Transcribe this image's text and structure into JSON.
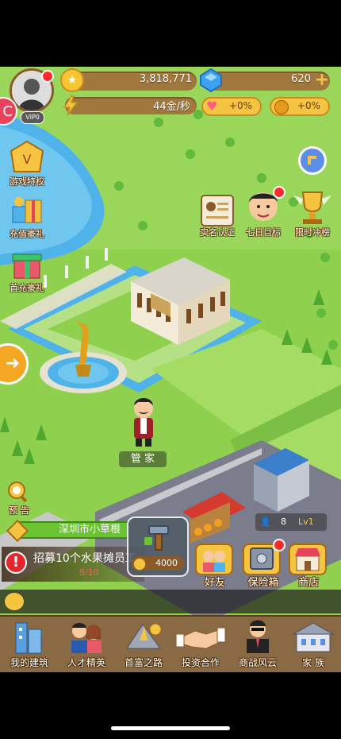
{
  "hud": {
    "avatar_level": "VIP0",
    "gold": "3,818,771",
    "diamonds": "620",
    "income": "44金/秒",
    "bonus_heart": "+0%",
    "bonus_coin": "+0%"
  },
  "left_menu": [
    {
      "label": "游戏特权",
      "icon": "vip-crown-icon"
    },
    {
      "label": "充值豪礼",
      "icon": "gift-pile-icon"
    },
    {
      "label": "首充豪礼",
      "icon": "gift-box-icon"
    }
  ],
  "events": [
    {
      "label": "实名认证",
      "icon": "id-card-icon"
    },
    {
      "label": "七日目标",
      "icon": "character-avatar-icon"
    },
    {
      "label": "限时冲榜",
      "icon": "trophy-icon"
    }
  ],
  "map": {
    "character_name": "管 家",
    "preview_label": "预 告"
  },
  "location": {
    "name": "深圳市小草根"
  },
  "task": {
    "text": "招募10个水果摊员工",
    "progress": "8/10"
  },
  "build": {
    "cost": "4000"
  },
  "shop_stats": {
    "staff": "8",
    "level": "Lv1"
  },
  "right_buttons": [
    {
      "label": "好友",
      "icon": "friends-icon"
    },
    {
      "label": "保险箱",
      "icon": "safe-icon"
    },
    {
      "label": "商店",
      "icon": "shop-icon"
    }
  ],
  "bottom_nav": [
    {
      "label": "我的建筑",
      "icon": "buildings-icon"
    },
    {
      "label": "人才精英",
      "icon": "talents-icon"
    },
    {
      "label": "首富之路",
      "icon": "road-icon"
    },
    {
      "label": "投资合作",
      "icon": "handshake-icon"
    },
    {
      "label": "商战风云",
      "icon": "businessman-icon"
    },
    {
      "label": "家 族",
      "icon": "family-house-icon"
    }
  ],
  "colors": {
    "grass": "#8fd14f",
    "road": "#7b7d8c",
    "water": "#4fb2e8",
    "gold": "#f5c542",
    "brown": "#8a5a2b"
  }
}
